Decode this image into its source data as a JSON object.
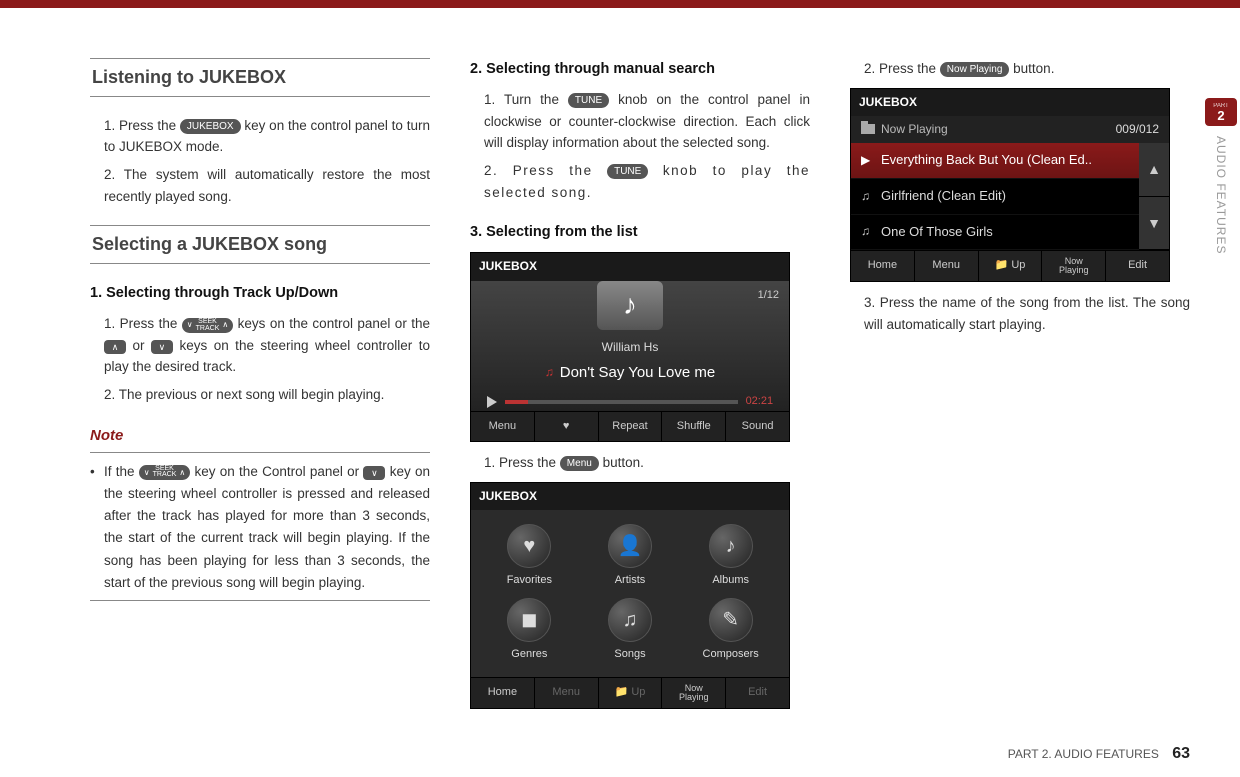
{
  "side_tab": {
    "part_label": "PART",
    "part_number": "2",
    "section": "AUDIO FEATURES"
  },
  "footer": {
    "label": "PART 2. AUDIO FEATURES",
    "page_number": "63"
  },
  "col1": {
    "heading1": "Listening to JUKEBOX",
    "listen_steps": {
      "s1a": "1. Press the ",
      "s1_key": "JUKEBOX",
      "s1b": " key on the control panel to turn to JUKEBOX mode.",
      "s2": "2. The system will automatically restore the most recently played song."
    },
    "heading2": "Selecting a JUKEBOX song",
    "sub1": "1. Selecting through Track Up/Down",
    "sel_steps": {
      "s1a": "1. Press the ",
      "seek1": "SEEK",
      "seek2": "TRACK",
      "s1b": " keys on the control panel or the ",
      "up": "∧",
      "or": " or ",
      "down": "∨",
      "s1c": " keys on the steering wheel controller to play the desired track.",
      "s2": "2. The previous or next song will begin playing."
    },
    "note_label": "Note",
    "note_body_a": "If the ",
    "note_body_b": " key on the Control panel or ",
    "note_body_c": " key on the steering wheel controller is pressed and released after the track has played for more than 3 seconds, the start of the current track will begin playing. If the song has been playing for less than 3 seconds, the start of the previous song will begin playing."
  },
  "col2": {
    "sub2": "2. Selecting through manual search",
    "ms": {
      "s1a": "1. Turn the ",
      "tune": "TUNE",
      "s1b": " knob on the control panel in clockwise or counter-clockwise direction. Each click will display information about the selected song.",
      "s2a": "2. Press the ",
      "s2b": " knob to play the selected song."
    },
    "sub3": "3. Selecting from the list",
    "player": {
      "title": "JUKEBOX",
      "counter": "1/12",
      "artist": "William Hs",
      "track": "Don't Say You Love me",
      "time": "02:21",
      "bb": {
        "menu": "Menu",
        "heart": "♥",
        "repeat": "Repeat",
        "shuffle": "Shuffle",
        "sound": "Sound"
      }
    },
    "after_player_a": "1. Press the ",
    "menu_key": "Menu",
    "after_player_b": " button.",
    "menugrid": {
      "title": "JUKEBOX",
      "cells": {
        "favorites": "Favorites",
        "artists": "Artists",
        "albums": "Albums",
        "genres": "Genres",
        "songs": "Songs",
        "composers": "Composers"
      },
      "icons": {
        "favorites": "♥",
        "artists": "👤",
        "albums": "♪",
        "genres": "◼",
        "songs": "♫",
        "composers": "✎"
      },
      "bb": {
        "home": "Home",
        "menu": "Menu",
        "up": "Up",
        "np1": "Now",
        "np2": "Playing",
        "edit": "Edit"
      }
    }
  },
  "col3": {
    "step2a": "2. Press the ",
    "np_key": "Now Playing",
    "step2b": " button.",
    "nowplaying": {
      "title": "JUKEBOX",
      "crumb": "Now Playing",
      "counter": "009/012",
      "rows": {
        "r1": "Everything Back But You (Clean Ed..",
        "r2": "Girlfriend (Clean Edit)",
        "r3": "One Of Those Girls"
      },
      "bb": {
        "home": "Home",
        "menu": "Menu",
        "up": "Up",
        "np1": "Now",
        "np2": "Playing",
        "edit": "Edit"
      }
    },
    "step3": "3. Press the name of the song from the list. The song will automatically start playing."
  }
}
